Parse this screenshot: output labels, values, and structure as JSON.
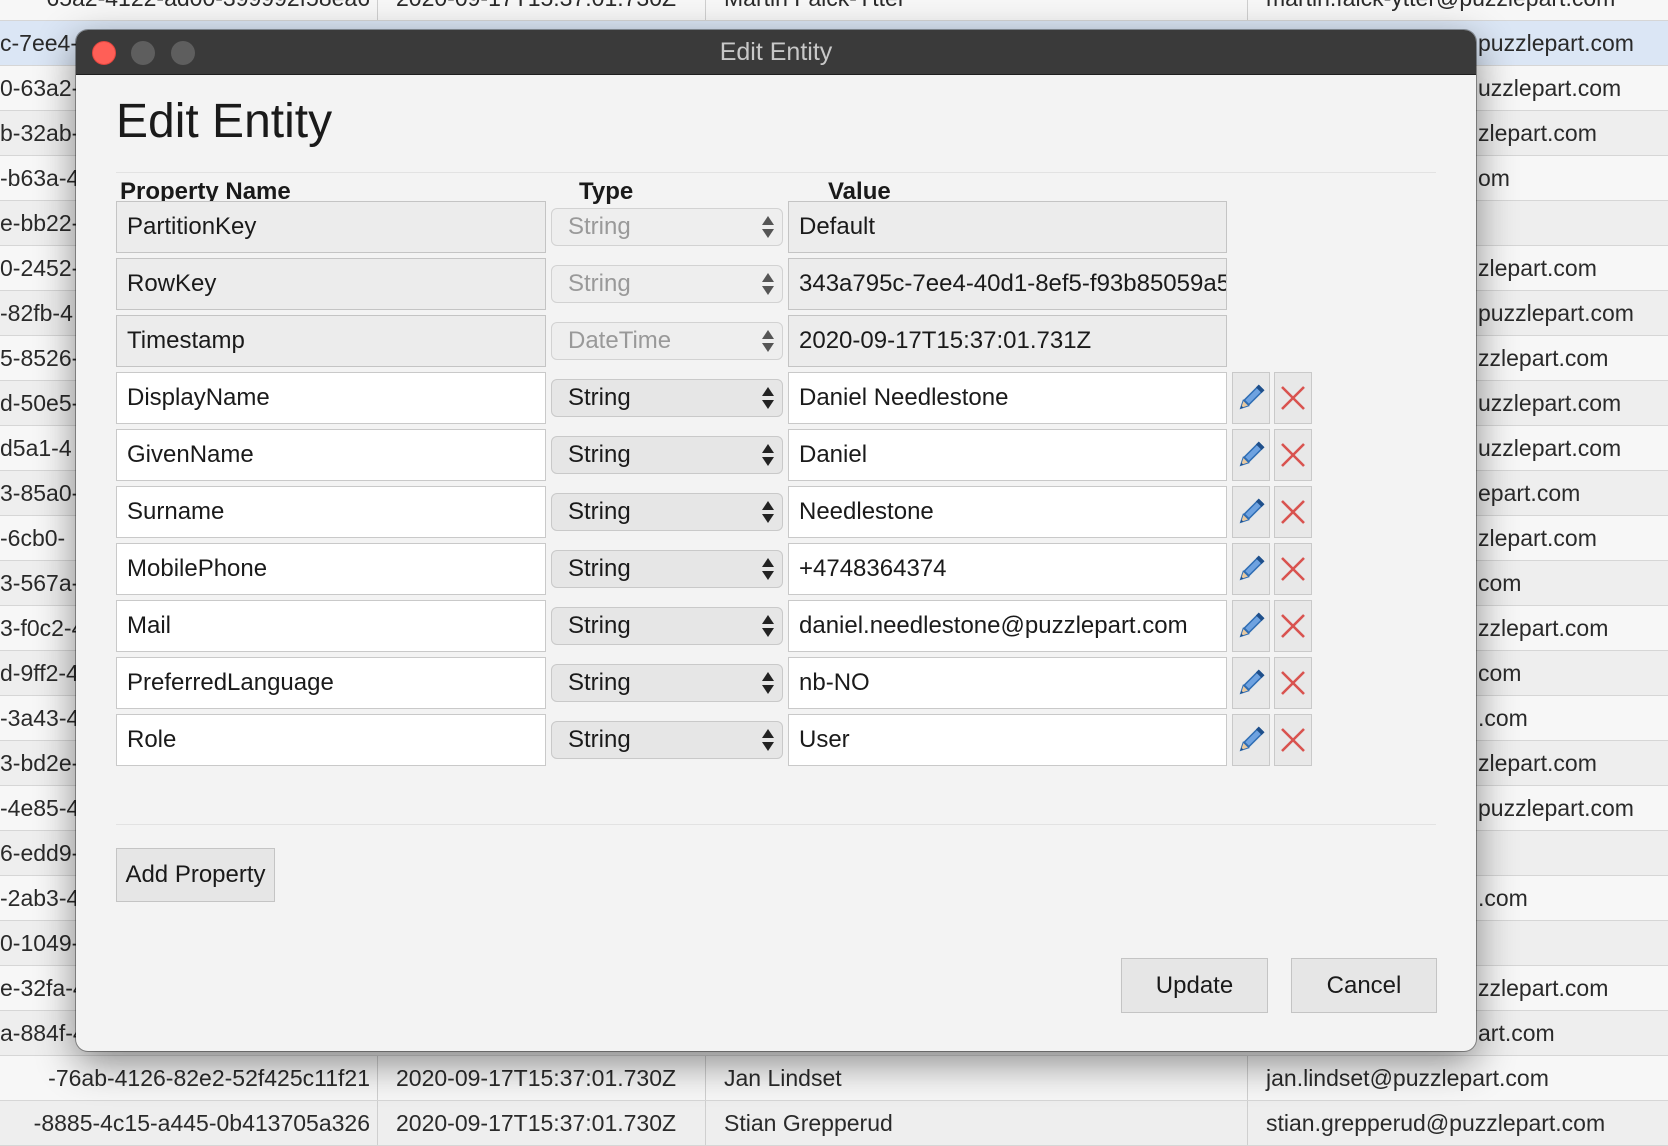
{
  "background_table": {
    "rows": [
      {
        "id": "65a2-4122-ad00-399992f58ea6",
        "timestamp": "2020-09-17T15:37:01.730Z",
        "name": "Martin Falck-Ytter",
        "email": "martin.falck-ytter@puzzlepart.com"
      },
      {
        "id": "c-7ee4-",
        "timestamp": "",
        "name": "",
        "email": "puzzlepart.com",
        "selected": true
      },
      {
        "id": "0-63a2-",
        "timestamp": "",
        "name": "",
        "email": "uzzlepart.com"
      },
      {
        "id": "b-32ab-",
        "timestamp": "",
        "name": "",
        "email": "zlepart.com"
      },
      {
        "id": "-b63a-4",
        "timestamp": "",
        "name": "",
        "email": "om"
      },
      {
        "id": "e-bb22-",
        "timestamp": "",
        "name": "",
        "email": ""
      },
      {
        "id": "0-2452-",
        "timestamp": "",
        "name": "",
        "email": "zlepart.com"
      },
      {
        "id": "-82fb-4",
        "timestamp": "",
        "name": "",
        "email": "puzzlepart.com"
      },
      {
        "id": "5-8526-",
        "timestamp": "",
        "name": "",
        "email": "zzlepart.com"
      },
      {
        "id": "d-50e5-",
        "timestamp": "",
        "name": "",
        "email": "uzzlepart.com"
      },
      {
        "id": "d5a1-4",
        "timestamp": "",
        "name": "",
        "email": "uzzlepart.com"
      },
      {
        "id": "3-85a0-",
        "timestamp": "",
        "name": "",
        "email": "epart.com"
      },
      {
        "id": "-6cb0-",
        "timestamp": "",
        "name": "",
        "email": "zlepart.com"
      },
      {
        "id": "3-567a-",
        "timestamp": "",
        "name": "",
        "email": "com"
      },
      {
        "id": "3-f0c2-4",
        "timestamp": "",
        "name": "",
        "email": "zzlepart.com"
      },
      {
        "id": "d-9ff2-4",
        "timestamp": "",
        "name": "",
        "email": "com"
      },
      {
        "id": "-3a43-4",
        "timestamp": "",
        "name": "",
        "email": ".com"
      },
      {
        "id": "3-bd2e-",
        "timestamp": "",
        "name": "",
        "email": "zlepart.com"
      },
      {
        "id": "-4e85-4",
        "timestamp": "",
        "name": "",
        "email": "puzzlepart.com"
      },
      {
        "id": "6-edd9-",
        "timestamp": "",
        "name": "",
        "email": ""
      },
      {
        "id": "-2ab3-4",
        "timestamp": "",
        "name": "",
        "email": ".com"
      },
      {
        "id": "0-1049-",
        "timestamp": "",
        "name": "",
        "email": ""
      },
      {
        "id": "e-32fa-4",
        "timestamp": "",
        "name": "",
        "email": "zzlepart.com"
      },
      {
        "id": "a-884f-4",
        "timestamp": "",
        "name": "",
        "email": "art.com"
      },
      {
        "id": "-76ab-4126-82e2-52f425c11f21",
        "timestamp": "2020-09-17T15:37:01.730Z",
        "name": "Jan Lindset",
        "email": "jan.lindset@puzzlepart.com"
      },
      {
        "id": "-8885-4c15-a445-0b413705a326",
        "timestamp": "2020-09-17T15:37:01.730Z",
        "name": "Stian Grepperud",
        "email": "stian.grepperud@puzzlepart.com"
      }
    ]
  },
  "dialog": {
    "window_title": "Edit Entity",
    "heading": "Edit Entity",
    "columns": {
      "name": "Property Name",
      "type": "Type",
      "value": "Value"
    },
    "properties": [
      {
        "name": "PartitionKey",
        "type": "String",
        "value": "Default",
        "readonly": true
      },
      {
        "name": "RowKey",
        "type": "String",
        "value": "343a795c-7ee4-40d1-8ef5-f93b85059a5(",
        "readonly": true
      },
      {
        "name": "Timestamp",
        "type": "DateTime",
        "value": "2020-09-17T15:37:01.731Z",
        "readonly": true
      },
      {
        "name": "DisplayName",
        "type": "String",
        "value": "Daniel Needlestone",
        "readonly": false
      },
      {
        "name": "GivenName",
        "type": "String",
        "value": "Daniel",
        "readonly": false
      },
      {
        "name": "Surname",
        "type": "String",
        "value": "Needlestone",
        "readonly": false
      },
      {
        "name": "MobilePhone",
        "type": "String",
        "value": "+4748364374",
        "readonly": false
      },
      {
        "name": "Mail",
        "type": "String",
        "value": "daniel.needlestone@puzzlepart.com",
        "readonly": false
      },
      {
        "name": "PreferredLanguage",
        "type": "String",
        "value": "nb-NO",
        "readonly": false
      },
      {
        "name": "Role",
        "type": "String",
        "value": "User",
        "readonly": false
      }
    ],
    "add_property_label": "Add Property",
    "update_label": "Update",
    "cancel_label": "Cancel"
  },
  "icons": {
    "edit": "pencil-icon",
    "delete": "close-icon"
  },
  "colors": {
    "pencil": "#2f6db3",
    "delete": "#d9534f",
    "close_light": "#ff5f57",
    "selected_row": "#dbe6f5"
  }
}
